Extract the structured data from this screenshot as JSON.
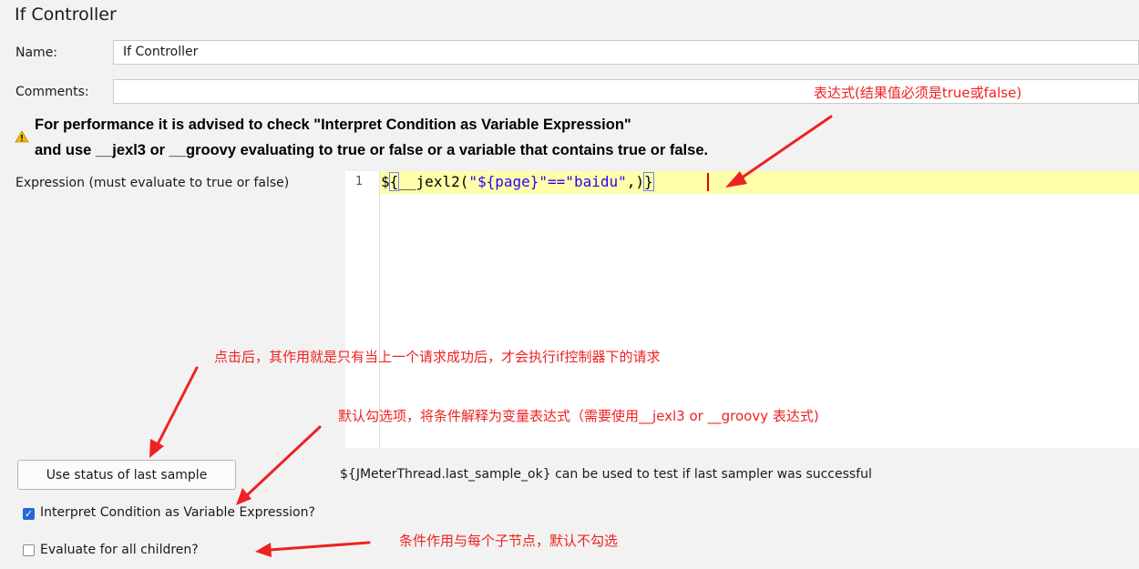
{
  "panel": {
    "title": "If Controller",
    "name_label": "Name:",
    "name_value": "If Controller",
    "comments_label": "Comments:",
    "comments_value": "",
    "warning_line1": "For performance it is advised to check \"Interpret Condition as Variable Expression\"",
    "warning_line2": "and use __jexl3 or __groovy evaluating to true or false or a variable that contains true or false.",
    "expression_label": "Expression (must evaluate to true or false)",
    "line_number": "1",
    "code": {
      "p1": "$",
      "p2": "{",
      "p3": "__jexl2(",
      "p4": "\"${page}\"==\"baidu\"",
      "p5": ",)",
      "p6": "}"
    },
    "button_label": "Use status of last sample",
    "hint": "${JMeterThread.last_sample_ok} can be used to test if last sampler was successful",
    "checkbox1_label": "Interpret Condition as Variable Expression?",
    "checkbox1_checked": true,
    "checkbox2_label": "Evaluate for all children?",
    "checkbox2_checked": false
  },
  "annotations": {
    "expr_note": "表达式(结果值必须是true或false)",
    "button_note": "点击后，其作用就是只有当上一个请求成功后，才会执行if控制器下的请求",
    "checkbox1_note": "默认勾选项，将条件解释为变量表达式（需要使用__jexl3 or __groovy 表达式)",
    "checkbox2_note": "条件作用与每个子节点，默认不勾选"
  },
  "colors": {
    "annotation": "#ee2222",
    "highlight": "#ffffa9",
    "checkbox_on": "#2468d6"
  }
}
